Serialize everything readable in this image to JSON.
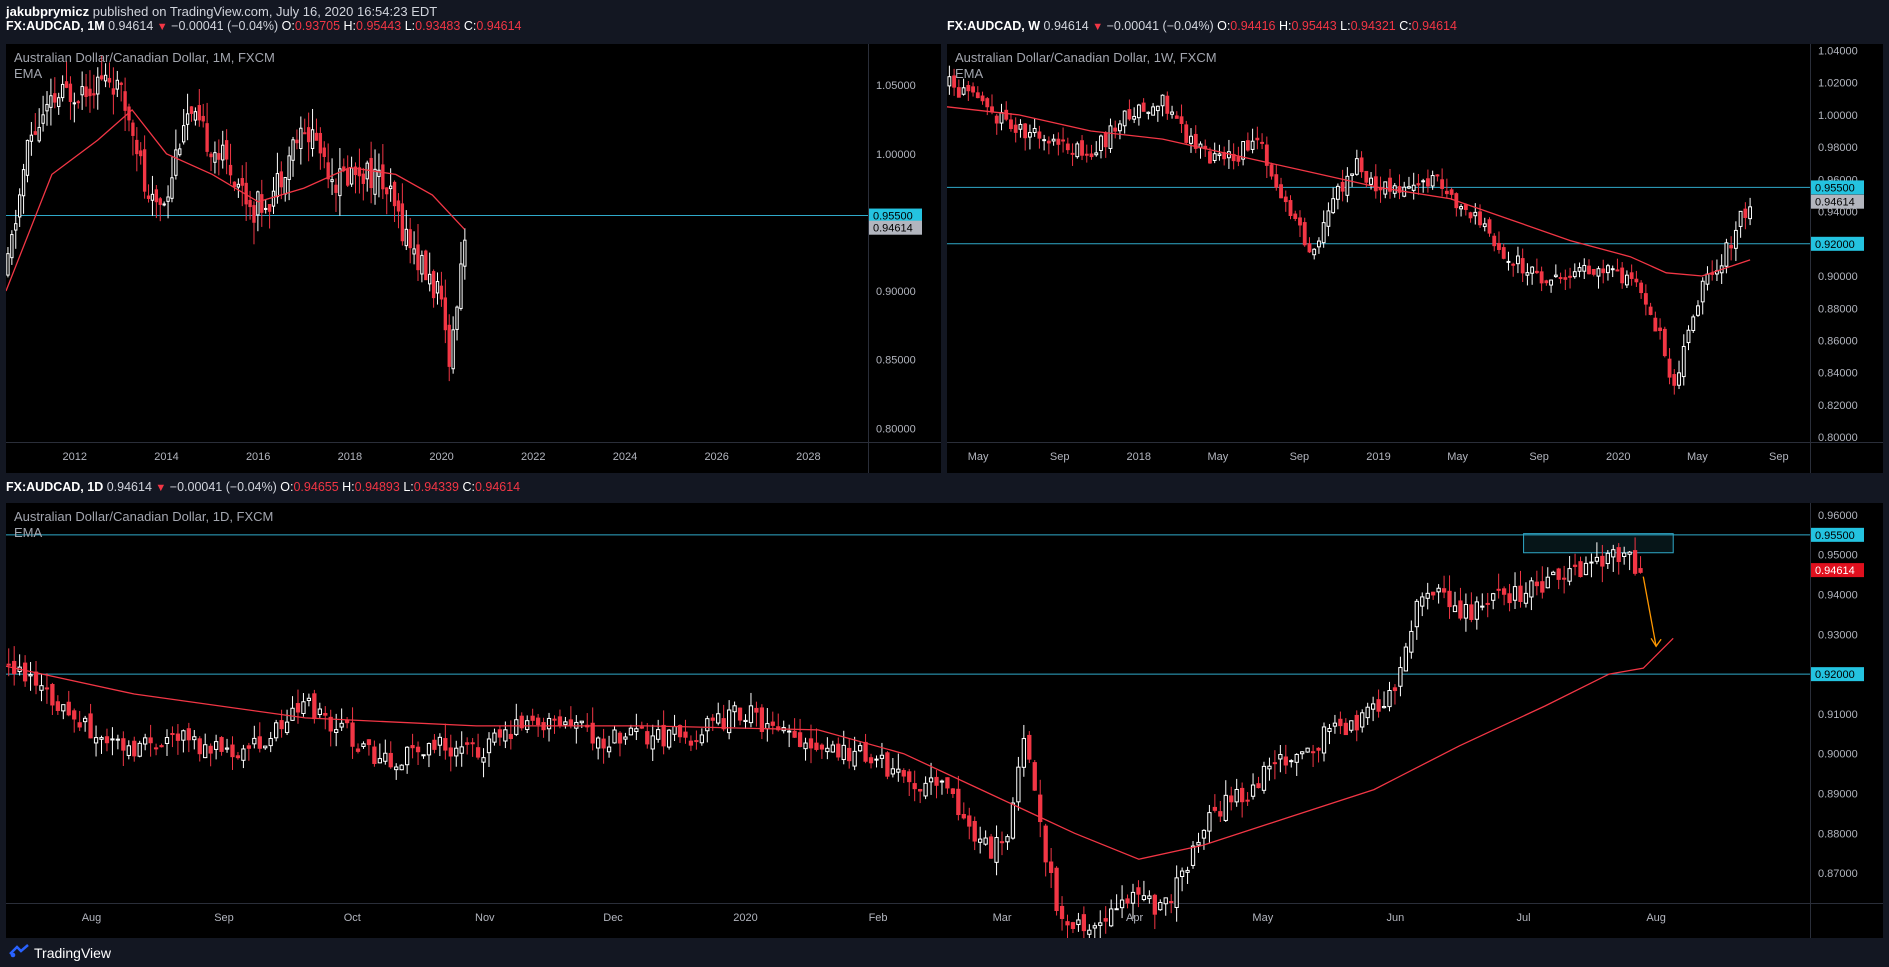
{
  "header": {
    "author": "jakubprymicz",
    "published": "published on TradingView.com, July 16, 2020 16:54:23 EDT"
  },
  "colors": {
    "background": "#131722",
    "panel": "#000000",
    "bull_candle": "#ffffff",
    "bear_candle": "#f23645",
    "ema": "#f23645",
    "level_line": "#2fa9c9",
    "level_label": "#24c3e0",
    "arrow": "#ff9800"
  },
  "panels": [
    {
      "id": "monthly",
      "symbol": "FX:AUDCAD, 1M",
      "last": "0.94614",
      "change": "−0.00041 (−0.04%)",
      "o_label": "O:",
      "open": "0.93705",
      "h_label": "H:",
      "high": "0.95443",
      "l_label": "L:",
      "low": "0.93483",
      "c_label": "C:",
      "close": "0.94614",
      "title": "Australian Dollar/Canadian Dollar, 1M, FXCM",
      "indicator": "EMA"
    },
    {
      "id": "weekly",
      "symbol": "FX:AUDCAD, W",
      "last": "0.94614",
      "change": "−0.00041 (−0.04%)",
      "o_label": "O:",
      "open": "0.94416",
      "h_label": "H:",
      "high": "0.95443",
      "l_label": "L:",
      "low": "0.94321",
      "c_label": "C:",
      "close": "0.94614",
      "title": "Australian Dollar/Canadian Dollar, 1W, FXCM",
      "indicator": "EMA"
    },
    {
      "id": "daily",
      "symbol": "FX:AUDCAD, 1D",
      "last": "0.94614",
      "change": "−0.00041 (−0.04%)",
      "o_label": "O:",
      "open": "0.94655",
      "h_label": "H:",
      "high": "0.94893",
      "l_label": "L:",
      "low": "0.94339",
      "c_label": "C:",
      "close": "0.94614",
      "title": "Australian Dollar/Canadian Dollar, 1D, FXCM",
      "indicator": "EMA"
    }
  ],
  "chart_data": [
    {
      "type": "candlestick",
      "title": "Australian Dollar/Canadian Dollar, 1M, FXCM",
      "ylim": [
        0.79,
        1.08
      ],
      "y_ticks": [
        "1.05000",
        "1.00000",
        "0.95000",
        "0.90000",
        "0.85000",
        "0.80000"
      ],
      "y_tick_values": [
        1.05,
        1.0,
        0.95,
        0.9,
        0.85,
        0.8
      ],
      "x_ticks": [
        "2012",
        "2014",
        "2016",
        "2018",
        "2020",
        "2022",
        "2024",
        "2026",
        "2028"
      ],
      "x_tick_values": [
        2012,
        2014,
        2016,
        2018,
        2020,
        2022,
        2024,
        2026,
        2028
      ],
      "xlim": [
        2010.5,
        2029.3
      ],
      "horizontal_levels": [
        {
          "value": 0.955,
          "label": "0.95500"
        }
      ],
      "last_price": {
        "value": 0.94614,
        "label": "0.94614"
      },
      "ema_points": [
        [
          2010.5,
          0.9
        ],
        [
          2011.5,
          0.985
        ],
        [
          2012.5,
          1.01
        ],
        [
          2013.25,
          1.032
        ],
        [
          2014,
          1.0
        ],
        [
          2015,
          0.985
        ],
        [
          2016,
          0.965
        ],
        [
          2017,
          0.975
        ],
        [
          2018,
          0.99
        ],
        [
          2019,
          0.985
        ],
        [
          2019.8,
          0.97
        ],
        [
          2020.5,
          0.945
        ]
      ],
      "price_path": [
        [
          2010.5,
          0.91
        ],
        [
          2011.0,
          1.01
        ],
        [
          2011.6,
          1.04
        ],
        [
          2012.2,
          1.05
        ],
        [
          2012.8,
          1.055
        ],
        [
          2013.3,
          1.02
        ],
        [
          2013.6,
          0.96
        ],
        [
          2014.0,
          0.97
        ],
        [
          2014.4,
          1.03
        ],
        [
          2014.9,
          1.01
        ],
        [
          2015.4,
          0.99
        ],
        [
          2015.9,
          0.96
        ],
        [
          2016.3,
          0.97
        ],
        [
          2016.8,
          1.01
        ],
        [
          2017.2,
          1.015
        ],
        [
          2017.7,
          0.98
        ],
        [
          2018.2,
          0.99
        ],
        [
          2018.7,
          0.98
        ],
        [
          2019.1,
          0.95
        ],
        [
          2019.6,
          0.915
        ],
        [
          2019.9,
          0.9
        ],
        [
          2020.2,
          0.85
        ],
        [
          2020.4,
          0.92
        ],
        [
          2020.55,
          0.946
        ]
      ]
    },
    {
      "type": "candlestick",
      "title": "Australian Dollar/Canadian Dollar, 1W, FXCM",
      "ylim": [
        0.797,
        1.044
      ],
      "y_ticks": [
        "1.04000",
        "1.02000",
        "1.00000",
        "0.98000",
        "0.96000",
        "0.94000",
        "0.92000",
        "0.90000",
        "0.88000",
        "0.86000",
        "0.84000",
        "0.82000",
        "0.80000"
      ],
      "y_tick_values": [
        1.04,
        1.02,
        1.0,
        0.98,
        0.96,
        0.94,
        0.92,
        0.9,
        0.88,
        0.86,
        0.84,
        0.82,
        0.8
      ],
      "x_ticks": [
        "May",
        "Sep",
        "2018",
        "May",
        "Sep",
        "2019",
        "May",
        "Sep",
        "2020",
        "May",
        "Sep"
      ],
      "x_tick_values": [
        2017.33,
        2017.67,
        2018.0,
        2018.33,
        2018.67,
        2019.0,
        2019.33,
        2019.67,
        2020.0,
        2020.33,
        2020.67
      ],
      "xlim": [
        2017.2,
        2020.8
      ],
      "horizontal_levels": [
        {
          "value": 0.955,
          "label": "0.95500"
        },
        {
          "value": 0.92,
          "label": "0.92000"
        }
      ],
      "last_price": {
        "value": 0.94614,
        "label": "0.94614"
      },
      "ema_points": [
        [
          2017.2,
          1.005
        ],
        [
          2017.5,
          1.0
        ],
        [
          2017.8,
          0.99
        ],
        [
          2018.1,
          0.985
        ],
        [
          2018.4,
          0.975
        ],
        [
          2018.7,
          0.965
        ],
        [
          2019.0,
          0.955
        ],
        [
          2019.3,
          0.948
        ],
        [
          2019.55,
          0.935
        ],
        [
          2019.8,
          0.922
        ],
        [
          2020.05,
          0.912
        ],
        [
          2020.2,
          0.902
        ],
        [
          2020.35,
          0.9
        ],
        [
          2020.55,
          0.91
        ]
      ],
      "price_path": [
        [
          2017.2,
          1.02
        ],
        [
          2017.35,
          1.005
        ],
        [
          2017.5,
          0.99
        ],
        [
          2017.65,
          0.985
        ],
        [
          2017.8,
          0.975
        ],
        [
          2017.95,
          1.0
        ],
        [
          2018.1,
          1.01
        ],
        [
          2018.2,
          0.985
        ],
        [
          2018.35,
          0.97
        ],
        [
          2018.5,
          0.985
        ],
        [
          2018.62,
          0.94
        ],
        [
          2018.72,
          0.915
        ],
        [
          2018.8,
          0.945
        ],
        [
          2018.9,
          0.97
        ],
        [
          2019.0,
          0.955
        ],
        [
          2019.1,
          0.955
        ],
        [
          2019.25,
          0.96
        ],
        [
          2019.4,
          0.935
        ],
        [
          2019.55,
          0.912
        ],
        [
          2019.7,
          0.898
        ],
        [
          2019.85,
          0.905
        ],
        [
          2020.0,
          0.9
        ],
        [
          2020.1,
          0.89
        ],
        [
          2020.18,
          0.86
        ],
        [
          2020.22,
          0.83
        ],
        [
          2020.28,
          0.855
        ],
        [
          2020.35,
          0.895
        ],
        [
          2020.45,
          0.915
        ],
        [
          2020.52,
          0.94
        ],
        [
          2020.56,
          0.946
        ]
      ]
    },
    {
      "type": "candlestick",
      "title": "Australian Dollar/Canadian Dollar, 1D, FXCM",
      "ylim": [
        0.8625,
        0.963
      ],
      "y_ticks": [
        "0.96000",
        "0.95000",
        "0.94000",
        "0.93000",
        "0.92000",
        "0.91000",
        "0.90000",
        "0.89000",
        "0.88000",
        "0.87000"
      ],
      "y_tick_values": [
        0.96,
        0.95,
        0.94,
        0.93,
        0.92,
        0.91,
        0.9,
        0.89,
        0.88,
        0.87
      ],
      "x_ticks": [
        "Aug",
        "Sep",
        "Oct",
        "Nov",
        "Dec",
        "2020",
        "Feb",
        "Mar",
        "Apr",
        "May",
        "Jun",
        "Jul",
        "Aug"
      ],
      "x_tick_values": [
        0,
        31,
        61,
        92,
        122,
        153,
        184,
        213,
        244,
        274,
        305,
        335,
        366
      ],
      "xlim": [
        -20,
        402
      ],
      "horizontal_levels": [
        {
          "value": 0.955,
          "label": "0.95500"
        },
        {
          "value": 0.92,
          "label": "0.92000"
        }
      ],
      "last_price": {
        "value": 0.94614,
        "label": "0.94614"
      },
      "resistance_zone": {
        "x_from": 335,
        "x_to": 370,
        "y_from": 0.9505,
        "y_to": 0.9553
      },
      "arrow": {
        "from": [
          363,
          0.9445
        ],
        "to": [
          366,
          0.927
        ]
      },
      "ema_points": [
        [
          -20,
          0.922
        ],
        [
          10,
          0.915
        ],
        [
          50,
          0.909
        ],
        [
          90,
          0.907
        ],
        [
          130,
          0.907
        ],
        [
          170,
          0.906
        ],
        [
          190,
          0.9
        ],
        [
          210,
          0.89
        ],
        [
          230,
          0.88
        ],
        [
          245,
          0.8735
        ],
        [
          260,
          0.877
        ],
        [
          280,
          0.884
        ],
        [
          300,
          0.891
        ],
        [
          320,
          0.902
        ],
        [
          340,
          0.912
        ],
        [
          355,
          0.92
        ],
        [
          363,
          0.9215
        ],
        [
          370,
          0.929
        ]
      ],
      "price_path": [
        [
          -20,
          0.922
        ],
        [
          -10,
          0.915
        ],
        [
          0,
          0.905
        ],
        [
          10,
          0.902
        ],
        [
          20,
          0.905
        ],
        [
          30,
          0.9
        ],
        [
          40,
          0.903
        ],
        [
          50,
          0.913
        ],
        [
          60,
          0.905
        ],
        [
          70,
          0.897
        ],
        [
          80,
          0.903
        ],
        [
          90,
          0.9
        ],
        [
          100,
          0.907
        ],
        [
          110,
          0.908
        ],
        [
          120,
          0.903
        ],
        [
          130,
          0.905
        ],
        [
          140,
          0.904
        ],
        [
          150,
          0.91
        ],
        [
          153,
          0.911
        ],
        [
          160,
          0.905
        ],
        [
          170,
          0.903
        ],
        [
          180,
          0.9
        ],
        [
          190,
          0.895
        ],
        [
          200,
          0.89
        ],
        [
          210,
          0.875
        ],
        [
          215,
          0.883
        ],
        [
          218,
          0.905
        ],
        [
          222,
          0.88
        ],
        [
          226,
          0.86
        ],
        [
          232,
          0.855
        ],
        [
          240,
          0.86
        ],
        [
          246,
          0.865
        ],
        [
          250,
          0.86
        ],
        [
          256,
          0.87
        ],
        [
          262,
          0.885
        ],
        [
          270,
          0.89
        ],
        [
          280,
          0.9
        ],
        [
          290,
          0.905
        ],
        [
          300,
          0.91
        ],
        [
          305,
          0.915
        ],
        [
          310,
          0.938
        ],
        [
          315,
          0.94
        ],
        [
          320,
          0.935
        ],
        [
          330,
          0.94
        ],
        [
          340,
          0.942
        ],
        [
          350,
          0.948
        ],
        [
          357,
          0.951
        ],
        [
          363,
          0.946
        ]
      ]
    }
  ],
  "footer": {
    "brand": "TradingView"
  }
}
